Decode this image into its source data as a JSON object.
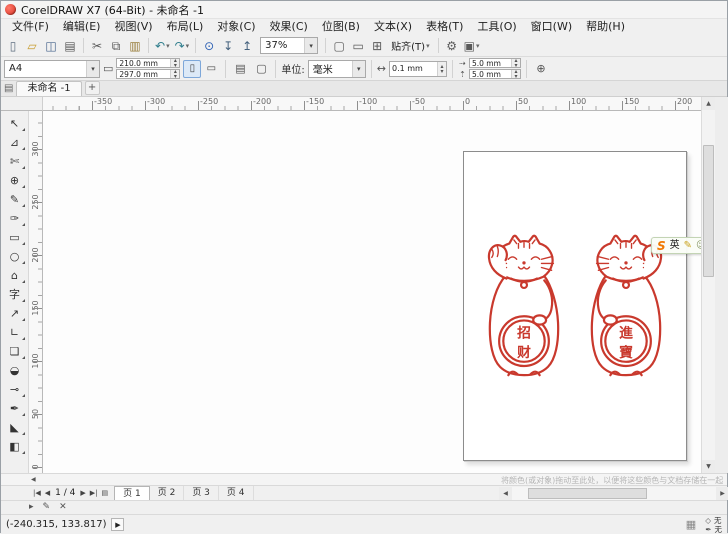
{
  "window": {
    "title": "CorelDRAW X7 (64-Bit) - 未命名 -1"
  },
  "menu": {
    "items": [
      "文件(F)",
      "编辑(E)",
      "视图(V)",
      "布局(L)",
      "对象(C)",
      "效果(C)",
      "位图(B)",
      "文本(X)",
      "表格(T)",
      "工具(O)",
      "窗口(W)",
      "帮助(H)"
    ]
  },
  "toolbar": {
    "zoom_value": "37%",
    "snap_label": "贴齐(T)",
    "items": [
      {
        "type": "btn",
        "name": "new-document",
        "glyph": "▯",
        "color": "#5f6f81"
      },
      {
        "type": "btn",
        "name": "open-document",
        "glyph": "▱",
        "color": "#c79c2e"
      },
      {
        "type": "btn",
        "name": "save-document",
        "glyph": "◫",
        "color": "#46648c"
      },
      {
        "type": "btn",
        "name": "print",
        "glyph": "▤",
        "color": "#5a5a5a"
      },
      {
        "type": "sep"
      },
      {
        "type": "btn",
        "name": "cut",
        "glyph": "✂",
        "color": "#5a5a5a"
      },
      {
        "type": "btn",
        "name": "copy",
        "glyph": "⧉",
        "color": "#5a5a5a"
      },
      {
        "type": "btn",
        "name": "paste",
        "glyph": "▥",
        "color": "#9a7f3e"
      },
      {
        "type": "sep"
      },
      {
        "type": "btn",
        "name": "undo",
        "glyph": "↶",
        "color": "#2e7d8c",
        "dropdown": true
      },
      {
        "type": "btn",
        "name": "redo",
        "glyph": "↷",
        "color": "#2e7d8c",
        "dropdown": true
      },
      {
        "type": "sep"
      },
      {
        "type": "btn",
        "name": "search-content",
        "glyph": "⊙",
        "color": "#2b5fb4"
      },
      {
        "type": "btn",
        "name": "import",
        "glyph": "↧",
        "color": "#44617d"
      },
      {
        "type": "btn",
        "name": "export",
        "glyph": "↥",
        "color": "#44617d"
      },
      {
        "type": "zoom",
        "name": "zoom-level-combo"
      },
      {
        "type": "sep"
      },
      {
        "type": "btn",
        "name": "fullscreen-preview",
        "glyph": "▢",
        "color": "#5a5a5a"
      },
      {
        "type": "btn",
        "name": "show-rulers",
        "glyph": "▭",
        "color": "#5a5a5a"
      },
      {
        "type": "btn",
        "name": "show-grid",
        "glyph": "⊞",
        "color": "#5a5a5a"
      },
      {
        "type": "snap",
        "name": "snap-to-dropdown"
      },
      {
        "type": "sep"
      },
      {
        "type": "btn",
        "name": "options",
        "glyph": "⚙",
        "color": "#5a5a5a"
      },
      {
        "type": "btn",
        "name": "application-launcher",
        "glyph": "▣",
        "color": "#5a5a5a",
        "dropdown": true
      }
    ]
  },
  "property_bar": {
    "page_preset": "A4",
    "page_width": "210.0 mm",
    "page_height": "297.0 mm",
    "units_label": "单位:",
    "units_value": "毫米",
    "nudge_value": "0.1 mm",
    "duplicate_x": "5.0 mm",
    "duplicate_y": "5.0 mm",
    "icons": {
      "page_dims": "▭",
      "portrait": "▯",
      "landscape": "▭",
      "all_pages": "▤",
      "current_page": "▢",
      "nudge": "↔",
      "dup_x": "⇢",
      "dup_y": "⇡",
      "plus_button": "⊕"
    }
  },
  "document_tabs": {
    "icon": "▤",
    "tabs": [
      "未命名 -1"
    ],
    "new_tab_label": "+"
  },
  "rulers": {
    "h_start": 49,
    "h_step": 53,
    "h_labels": [
      "-350",
      "-300",
      "-250",
      "-200",
      "-150",
      "-100",
      "-50",
      "0",
      "50",
      "100",
      "150",
      "200"
    ],
    "v_start": 32,
    "v_step": 53,
    "v_labels": [
      "300",
      "250",
      "200",
      "150",
      "100",
      "50",
      "0"
    ]
  },
  "toolbox": {
    "tools": [
      {
        "name": "pick-tool",
        "glyph": "↖",
        "flyout": true
      },
      {
        "name": "shape-tool",
        "glyph": "⊿",
        "flyout": true
      },
      {
        "name": "crop-tool",
        "glyph": "✄",
        "flyout": true
      },
      {
        "name": "zoom-tool",
        "glyph": "⊕",
        "flyout": true
      },
      {
        "name": "freehand-tool",
        "glyph": "✎",
        "flyout": true
      },
      {
        "name": "artistic-media-tool",
        "glyph": "✑",
        "flyout": true
      },
      {
        "name": "rectangle-tool",
        "glyph": "▭",
        "flyout": true
      },
      {
        "name": "ellipse-tool",
        "glyph": "○",
        "flyout": true
      },
      {
        "name": "polygon-tool",
        "glyph": "⌂",
        "flyout": true
      },
      {
        "name": "text-tool",
        "glyph": "字",
        "flyout": true
      },
      {
        "name": "parallel-dimension-tool",
        "glyph": "↗",
        "flyout": true
      },
      {
        "name": "connector-tool",
        "glyph": "∟",
        "flyout": true
      },
      {
        "name": "drop-shadow-tool",
        "glyph": "❏",
        "flyout": true
      },
      {
        "name": "transparency-tool",
        "glyph": "◒",
        "flyout": false
      },
      {
        "name": "color-eyedropper-tool",
        "glyph": "⊸",
        "flyout": true
      },
      {
        "name": "outline-pen-tool",
        "glyph": "✒",
        "flyout": true
      },
      {
        "name": "fill-tool",
        "glyph": "◣",
        "flyout": true
      },
      {
        "name": "interactive-fill-tool",
        "glyph": "◧",
        "flyout": true
      }
    ]
  },
  "canvas": {
    "cat_color": "#c9392d",
    "cats": [
      {
        "char_top": "招",
        "char_bottom": "财"
      },
      {
        "char_top": "進",
        "char_bottom": "寶"
      }
    ]
  },
  "ime_bar": {
    "logo": "S",
    "logo_color": "#f07800",
    "mode_label": "英",
    "pen_icon": "✎",
    "emoji_icon": "☺"
  },
  "bottom": {
    "palette_hint": "将颜色(或对象)拖动至此处，以便将这些颜色与文档存储在一起",
    "page_counter": "1 / 4",
    "nav": {
      "first": "|◀",
      "prev": "◀",
      "next": "▶",
      "last": "▶|",
      "page_icon": "▤"
    },
    "page_tabs": [
      "页 1",
      "页 2",
      "页 3",
      "页 4"
    ]
  },
  "status_bar": {
    "coordinates": "(-240.315, 133.817)",
    "expand_button": "▶",
    "icons": [
      {
        "name": "flyout-arrow-icon",
        "glyph": "▸"
      },
      {
        "name": "pen-icon",
        "glyph": "✎"
      },
      {
        "name": "delete-icon",
        "glyph": "✕"
      }
    ],
    "grid_icon": "▦",
    "fill_icon": "◇",
    "fill_none_label": "无",
    "outline_icon": "✒",
    "outline_none_label": "无"
  },
  "glyphs": {
    "chevron_down": "▾",
    "spin_up": "▴",
    "spin_down": "▾",
    "scroll_left": "◀",
    "scroll_right": "▶",
    "scroll_up": "▲",
    "scroll_down": "▼",
    "flyout_left": "◀"
  }
}
